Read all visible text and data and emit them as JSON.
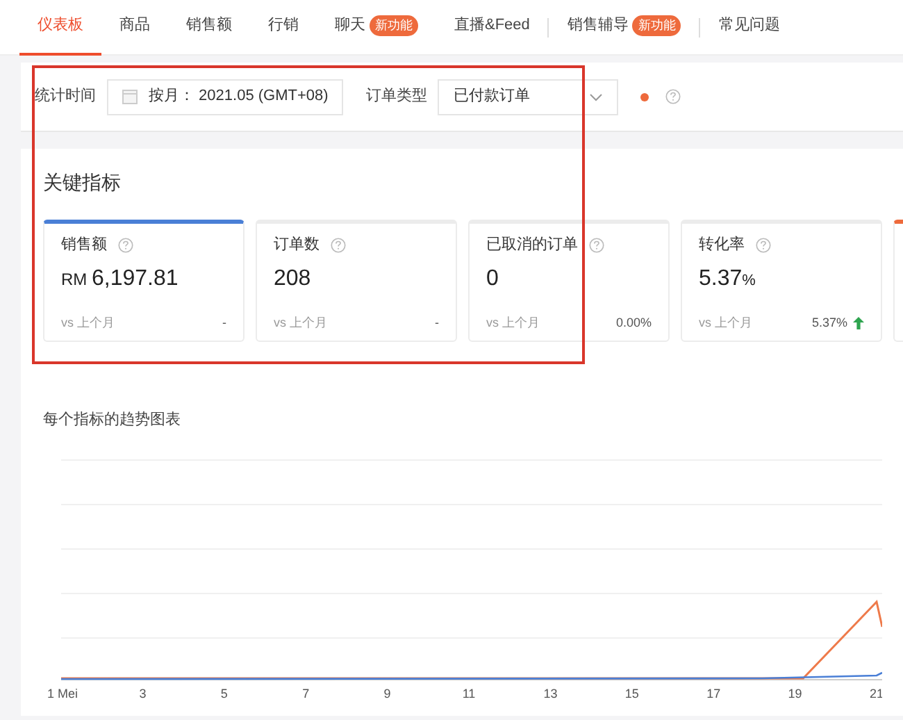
{
  "tabs": [
    {
      "label": "仪表板",
      "selected": true
    },
    {
      "label": "商品",
      "selected": false
    },
    {
      "label": "销售额",
      "selected": false
    },
    {
      "label": "行销",
      "selected": false
    },
    {
      "label": "聊天",
      "selected": false,
      "badge": "新功能"
    },
    {
      "label": "直播&Feed",
      "selected": false,
      "separator_after": true
    },
    {
      "label": "销售辅导",
      "selected": false,
      "badge": "新功能",
      "separator_after": true
    },
    {
      "label": "常见问题",
      "selected": false
    }
  ],
  "filters": {
    "period_label": "统计时间",
    "period_value": "按月： 2021.05 (GMT+08)",
    "order_type_label": "订单类型",
    "order_type_value": "已付款订单"
  },
  "key_metrics": {
    "title": "关键指标",
    "cards": [
      {
        "label": "销售额",
        "prefix": "RM",
        "value": "6,197.81",
        "compare": "vs 上个月",
        "change": "-",
        "rising": false,
        "color": "#4a7fd6"
      },
      {
        "label": "订单数",
        "value": "208",
        "compare": "vs 上个月",
        "change": "-",
        "rising": false
      },
      {
        "label": "已取消的订单",
        "value": "0",
        "compare": "vs 上个月",
        "change": "0.00%",
        "rising": false
      },
      {
        "label": "转化率",
        "value": "5.37",
        "unit": "%",
        "compare": "vs 上个月",
        "change": "5.37%",
        "rising": true
      },
      {
        "color": "#ee6a3c"
      }
    ]
  },
  "trend_chart": {
    "title": "每个指标的趋势图表",
    "x_axis_labels": [
      "1 Mei",
      "3",
      "5",
      "7",
      "9",
      "11",
      "13",
      "15",
      "17",
      "19",
      "21"
    ]
  },
  "annotation": {
    "kind": "rectangle",
    "color": "#d9362b"
  }
}
